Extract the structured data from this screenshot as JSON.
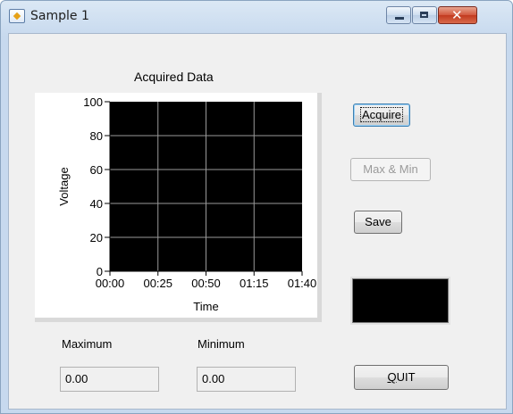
{
  "window": {
    "title": "Sample 1",
    "icon": "vi-app-icon"
  },
  "chart_data": {
    "type": "line",
    "title": "Acquired Data",
    "xlabel": "Time",
    "ylabel": "Voltage",
    "x_ticks": [
      "00:00",
      "00:25",
      "00:50",
      "01:15",
      "01:40"
    ],
    "y_ticks": [
      "0",
      "20",
      "40",
      "60",
      "80",
      "100"
    ],
    "xlim": [
      "00:00",
      "01:40"
    ],
    "ylim": [
      0,
      100
    ],
    "grid": true,
    "plot_background": "#000000",
    "grid_color": "#9a9a9a",
    "series": []
  },
  "buttons": {
    "acquire": "Acquire",
    "max_min": "Max & Min",
    "save": "Save",
    "quit_accel": "Q",
    "quit_rest": "UIT"
  },
  "fields": {
    "maximum_label": "Maximum",
    "maximum_value": "0.00",
    "minimum_label": "Minimum",
    "minimum_value": "0.00"
  },
  "indicator": {
    "color": "#000000"
  }
}
